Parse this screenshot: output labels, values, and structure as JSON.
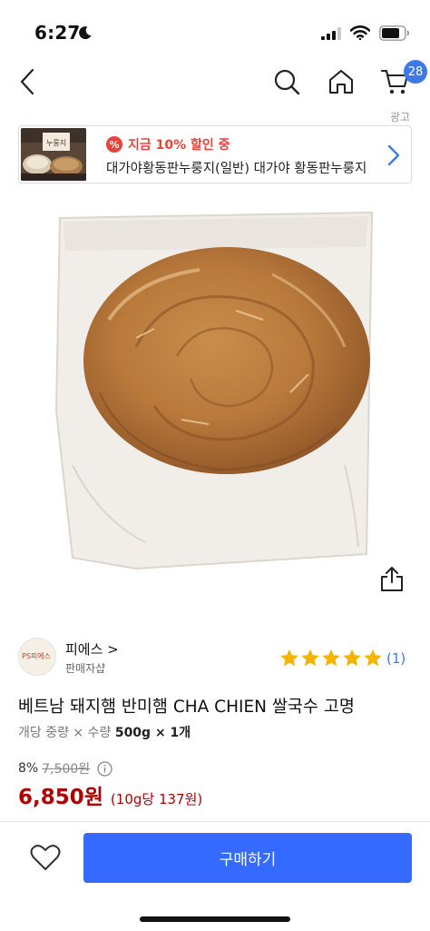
{
  "status_bar": {
    "time": "6:27"
  },
  "nav": {
    "cart_count": "28"
  },
  "ad_label": "광고",
  "ad_banner": {
    "discount_text": "지금 10% 할인 중",
    "discount_icon": "%",
    "title": "대가야황동판누룽지(일반) 대가야 황동판누룽지",
    "thumb_caption": "누룽지"
  },
  "seller": {
    "name": "피에스 >",
    "subtitle": "판매자샵",
    "avatar_text": "PS피에스",
    "rating_stars": 5,
    "review_count": "(1)"
  },
  "product": {
    "title": "베트남 돼지햄 반미햄 CHA CHIEN 쌀국수 고명",
    "option_label": "개당 중량 × 수량",
    "option_value": "500g × 1개",
    "discount_rate": "8%",
    "original_price": "7,500원",
    "sale_price": "6,850원",
    "unit_price": "(10g당 137원)"
  },
  "bottom": {
    "buy_label": "구매하기"
  },
  "colors": {
    "accent": "#346aff",
    "badge": "#3f79e6",
    "price": "#ae0000",
    "star": "#f4b400",
    "discount_red": "#e8433b"
  }
}
